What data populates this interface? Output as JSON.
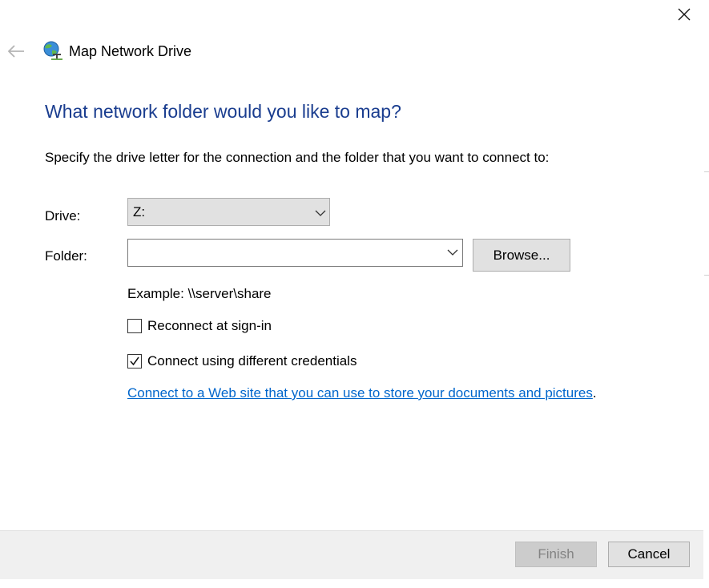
{
  "window": {
    "title": "Map Network Drive",
    "heading": "What network folder would you like to map?",
    "instructions": "Specify the drive letter for the connection and the folder that you want to connect to:",
    "close_icon": "close-icon",
    "back_icon": "back-arrow-icon",
    "app_icon": "network-drive-icon"
  },
  "form": {
    "drive_label": "Drive:",
    "drive_value": "Z:",
    "folder_label": "Folder:",
    "folder_value": "",
    "folder_placeholder": "",
    "browse_label": "Browse...",
    "example_text": "Example: \\\\server\\share",
    "reconnect_label": "Reconnect at sign-in",
    "reconnect_checked": false,
    "credentials_label": "Connect using different credentials",
    "credentials_checked": true,
    "link_text": "Connect to a Web site that you can use to store your documents and pictures",
    "link_suffix": "."
  },
  "footer": {
    "finish_label": "Finish",
    "finish_enabled": false,
    "cancel_label": "Cancel"
  },
  "colors": {
    "heading": "#1a3d8f",
    "link": "#0066cc",
    "button_face": "#e1e1e1",
    "button_border": "#adadad",
    "footer_bg": "#f0f0f0",
    "disabled_text": "#838383"
  }
}
